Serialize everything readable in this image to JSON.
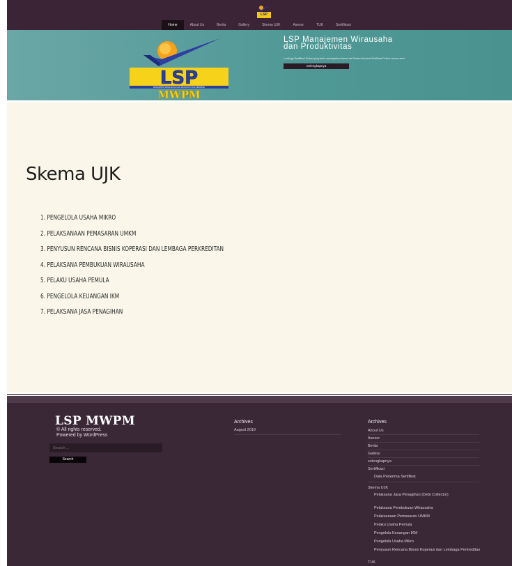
{
  "header": {
    "nav": [
      "Home",
      "About Us",
      "Berita",
      "Gallery",
      "Skema UJK",
      "Asesor",
      "TUK",
      "Sertifikasi"
    ],
    "active_nav": 0
  },
  "hero": {
    "title": "LSP Manajemen Wirausaha dan Produktivitas",
    "subtitle": "Lembaga Sertifikasi Profesi yang telah mendapatkan lisensi dari Badan Nasional Sertifikasi Profesi secara resmi",
    "button": "Selengkapnya",
    "logo_text": "LSP MWPM",
    "logo_subtext": "MANAJEMEN WIRAUSAHA DAN PRODUKTIVITAS MERDEKA"
  },
  "main": {
    "title": "Skema UJK",
    "items": [
      "1. PENGELOLA USAHA MIKRO",
      "2. PELAKSANAAN PEMASARAN UMKM",
      "3. PENYUSUN RENCANA BISNIS KOPERASI DAN LEMBAGA PERKREDITAN",
      "4. PELAKSANA PEMBUKUAN WIRAUSAHA",
      "5. PELAKU USAHA PEMULA",
      "6. PENGELOLA KEUANGAN IKM",
      "7. PELAKSANA JASA PENAGIHAN"
    ]
  },
  "footer": {
    "site_title": "LSP MWPM",
    "rights": "© All rights reserved.",
    "powered": "Powered by WordPress",
    "search_placeholder": "Search ...",
    "search_button": "Search",
    "archives_title": "Archives",
    "archives": [
      "August 2019"
    ],
    "pages_title": "Archives",
    "pages": [
      "About Us",
      "Asesor",
      "Berita",
      "Gallery",
      "selengkapnya",
      "Sertifikasi"
    ],
    "sertifikasi_sub": "Data Penerima Sertifikat",
    "skema_title": "Skema UJK",
    "skema_sub": [
      "Pelaksana Jasa Penagihan (Debt Collector)",
      "Pelaksana Pembukuan Wirausaha",
      "Pelaksanaan Pemasaran UMKM",
      "Pelaku Usaha Pemula",
      "Pengelola Keuangan IKM",
      "Pengelola Usaha Mikro",
      "Penyusun Rencana Bisnis Koperasi dan Lembaga Perkreditan"
    ],
    "tuk": "TUK"
  },
  "colors": {
    "header_bg": "#3a2436",
    "hero_bg": "#4f9896",
    "main_bg": "#faf7ea",
    "footer_bg": "#3b2837"
  }
}
